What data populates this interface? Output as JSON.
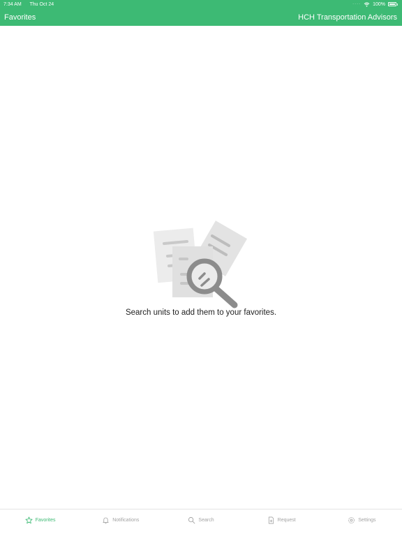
{
  "status_bar": {
    "time": "7:34 AM",
    "date": "Thu Oct 24",
    "battery": "100%"
  },
  "nav": {
    "title": "Favorites",
    "company": "HCH Transportation Advisors"
  },
  "empty_state": {
    "message": "Search units to add them to your favorites."
  },
  "tabs": [
    {
      "label": "Favorites",
      "icon": "star-icon",
      "active": true
    },
    {
      "label": "Notifications",
      "icon": "bell-icon",
      "active": false
    },
    {
      "label": "Search",
      "icon": "search-icon",
      "active": false
    },
    {
      "label": "Request",
      "icon": "request-icon",
      "active": false
    },
    {
      "label": "Settings",
      "icon": "gear-icon",
      "active": false
    }
  ],
  "colors": {
    "brand": "#3dba74",
    "tab_inactive": "#a3a3a3",
    "text": "#222222"
  }
}
